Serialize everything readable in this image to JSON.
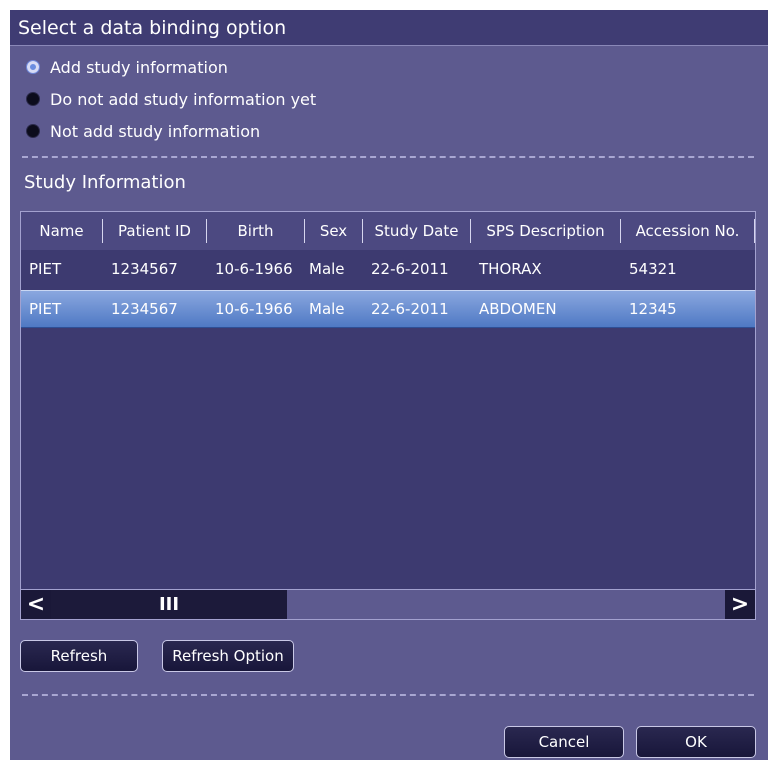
{
  "dialog": {
    "title": "Select a data binding option"
  },
  "binding_options": [
    {
      "label": "Add study information",
      "selected": true
    },
    {
      "label": "Do not add study information yet",
      "selected": false
    },
    {
      "label": "Not add study information",
      "selected": false
    }
  ],
  "study_section": {
    "label": "Study Information"
  },
  "table": {
    "columns": [
      "Name",
      "Patient ID",
      "Birth",
      "Sex",
      "Study Date",
      "SPS Description",
      "Accession No."
    ],
    "rows": [
      {
        "cells": [
          "PIET",
          "1234567",
          "10-6-1966",
          "Male",
          "22-6-2011",
          "THORAX",
          "54321"
        ],
        "selected": false
      },
      {
        "cells": [
          "PIET",
          "1234567",
          "10-6-1966",
          "Male",
          "22-6-2011",
          "ABDOMEN",
          "12345"
        ],
        "selected": true
      }
    ]
  },
  "scrollbar": {
    "left_glyph": "<",
    "thumb_glyph": "III",
    "right_glyph": ">"
  },
  "buttons": {
    "refresh": "Refresh",
    "refresh_option": "Refresh Option",
    "cancel": "Cancel",
    "ok": "OK"
  },
  "colors": {
    "dialog_bg": "#5d5a8f",
    "title_bar": "#3f3c73",
    "table_bg": "#3d3a70",
    "selection": "#4f79c4"
  }
}
